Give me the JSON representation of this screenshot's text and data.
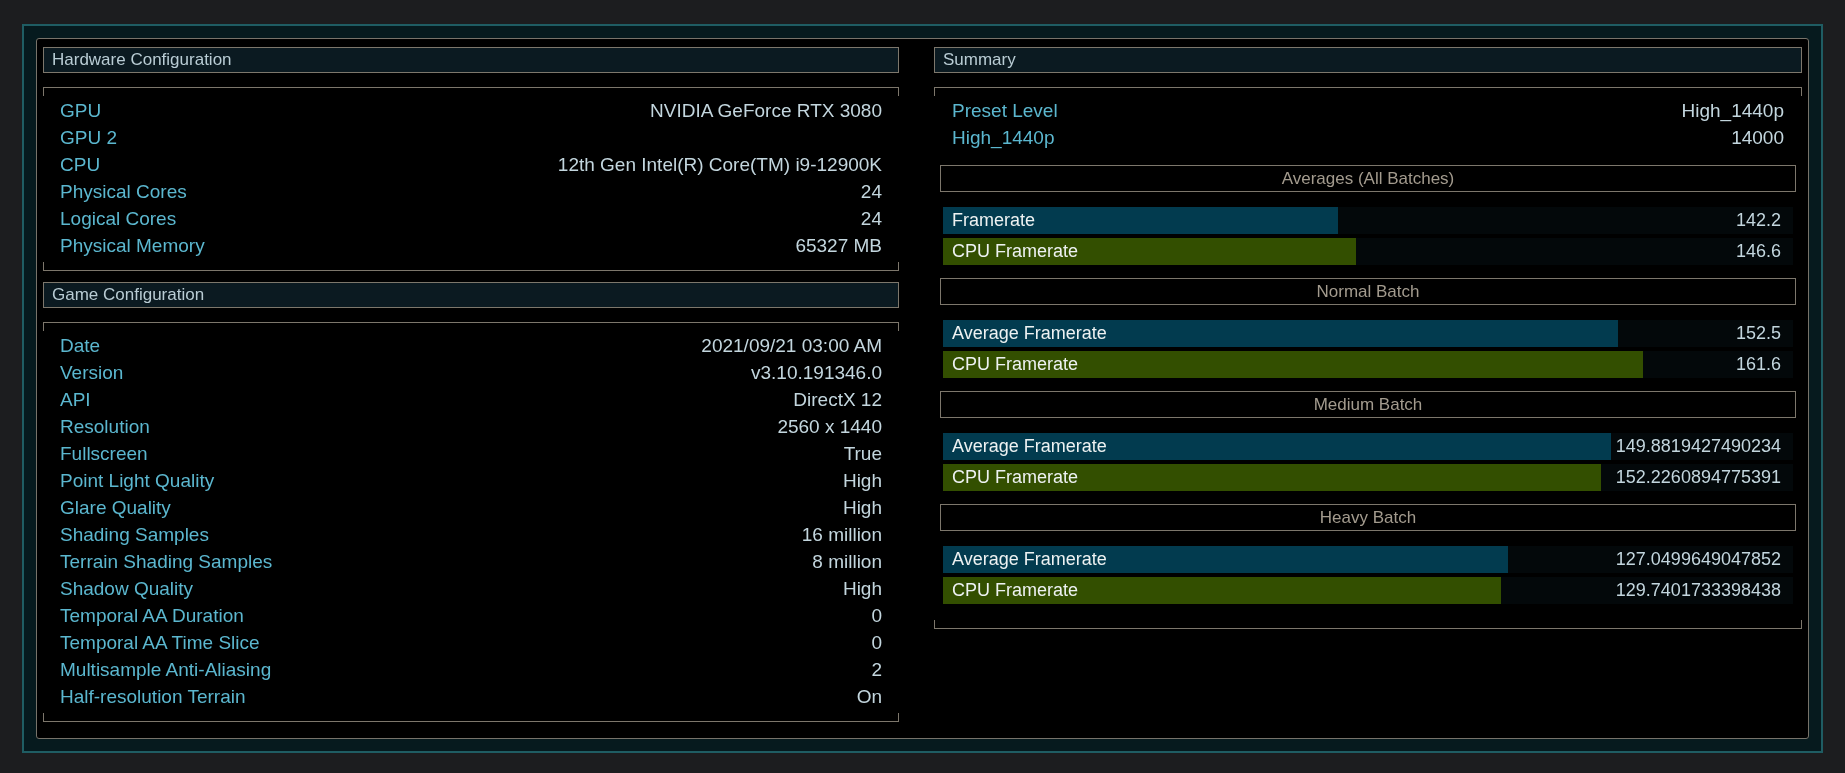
{
  "hardware_configuration": {
    "title": "Hardware Configuration",
    "rows": [
      {
        "label": "GPU",
        "value": "NVIDIA GeForce RTX 3080"
      },
      {
        "label": "GPU 2"
      },
      {
        "label": "CPU",
        "value": "12th Gen Intel(R) Core(TM) i9-12900K"
      },
      {
        "label": "Physical Cores",
        "value": "24"
      },
      {
        "label": "Logical Cores",
        "value": "24"
      },
      {
        "label": "Physical Memory",
        "value": "65327 MB"
      }
    ]
  },
  "game_configuration": {
    "title": "Game Configuration",
    "rows": [
      {
        "label": "Date",
        "value": "2021/09/21 03:00 AM"
      },
      {
        "label": "Version",
        "value": "v3.10.191346.0"
      },
      {
        "label": "API",
        "value": "DirectX 12"
      },
      {
        "label": "Resolution",
        "value": "2560 x 1440"
      },
      {
        "label": "Fullscreen",
        "value": "True"
      },
      {
        "label": "Point Light Quality",
        "value": "High"
      },
      {
        "label": "Glare Quality",
        "value": "High"
      },
      {
        "label": "Shading Samples",
        "value": "16 million"
      },
      {
        "label": "Terrain Shading Samples",
        "value": "8 million"
      },
      {
        "label": "Shadow Quality",
        "value": "High"
      },
      {
        "label": "Temporal AA Duration",
        "value": "0"
      },
      {
        "label": "Temporal AA Time Slice",
        "value": "0"
      },
      {
        "label": "Multisample Anti-Aliasing",
        "value": "2"
      },
      {
        "label": "Half-resolution Terrain",
        "value": "On"
      }
    ]
  },
  "summary": {
    "title": "Summary",
    "rows": [
      {
        "label": "Preset Level",
        "value": "High_1440p"
      },
      {
        "label": "High_1440p",
        "value": "14000"
      }
    ],
    "batches": [
      {
        "title": "Averages (All Batches)",
        "bars": [
          {
            "kind": "average",
            "label": "Framerate",
            "value": "142.2",
            "level": 0.465
          },
          {
            "kind": "cpu",
            "label": "CPU Framerate",
            "value": "146.6",
            "level": 0.486
          }
        ]
      },
      {
        "title": "Normal Batch",
        "bars": [
          {
            "kind": "average",
            "label": "Average Framerate",
            "value": "152.5",
            "level": 0.794
          },
          {
            "kind": "cpu",
            "label": "CPU Framerate",
            "value": "161.6",
            "level": 0.824
          }
        ]
      },
      {
        "title": "Medium Batch",
        "bars": [
          {
            "kind": "average",
            "label": "Average Framerate",
            "value": "149.8819427490234",
            "level": 0.786
          },
          {
            "kind": "cpu",
            "label": "CPU Framerate",
            "value": "152.2260894775391",
            "level": 0.774
          }
        ]
      },
      {
        "title": "Heavy Batch",
        "bars": [
          {
            "kind": "average",
            "label": "Average Framerate",
            "value": "127.0499649047852",
            "level": 0.665
          },
          {
            "kind": "cpu",
            "label": "CPU Framerate",
            "value": "129.7401733398438",
            "level": 0.656
          }
        ]
      }
    ]
  }
}
